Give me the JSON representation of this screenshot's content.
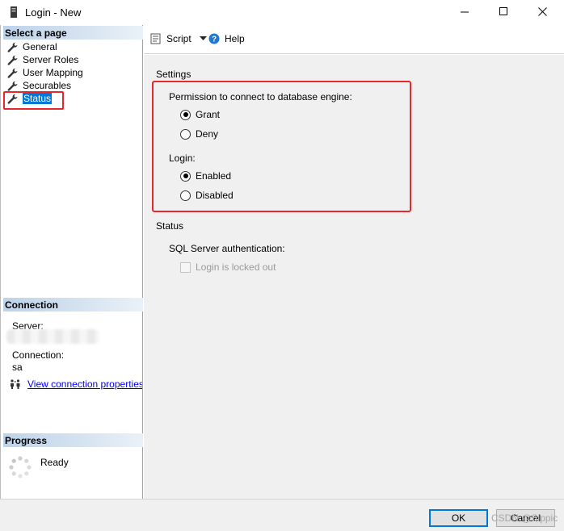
{
  "window": {
    "title": "Login - New"
  },
  "left": {
    "select_page_header": "Select a page",
    "pages": [
      {
        "label": "General"
      },
      {
        "label": "Server Roles"
      },
      {
        "label": "User Mapping"
      },
      {
        "label": "Securables"
      },
      {
        "label": "Status"
      }
    ],
    "selected_page": "Status",
    "connection_header": "Connection",
    "server_label": "Server:",
    "connection_label": "Connection:",
    "connection_value": "sa",
    "view_link": "View connection properties",
    "progress_header": "Progress",
    "progress_status": "Ready"
  },
  "toolbar": {
    "script_label": "Script",
    "help_label": "Help"
  },
  "settings": {
    "title": "Settings",
    "permission_label": "Permission to connect to database engine:",
    "grant_label": "Grant",
    "deny_label": "Deny",
    "permission_selected": "Grant",
    "login_label": "Login:",
    "enabled_label": "Enabled",
    "disabled_label": "Disabled",
    "login_selected": "Enabled"
  },
  "status": {
    "title": "Status",
    "auth_label": "SQL Server authentication:",
    "locked_out_label": "Login is locked out",
    "locked_out_checked": false
  },
  "buttons": {
    "ok_label": "OK",
    "cancel_label": "Cancel"
  },
  "watermark": "CSDN @Sippic",
  "colors": {
    "selection": "#0078d7",
    "highlight_box": "#e8262b",
    "link": "#0000ee"
  }
}
